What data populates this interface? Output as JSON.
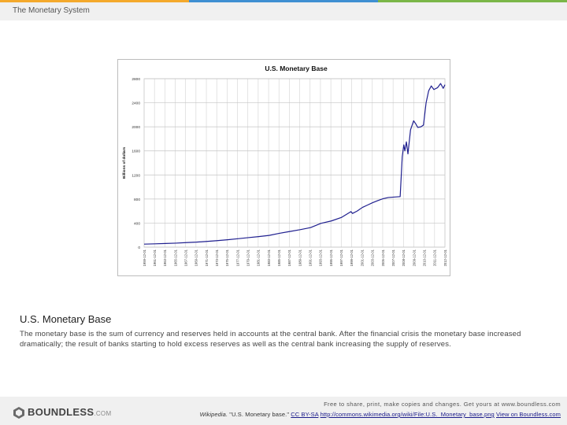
{
  "header": {
    "title": "The Monetary System"
  },
  "figure": {
    "caption_title": "U.S. Monetary Base",
    "caption_body": "The monetary base is the sum of currency and reserves held in accounts at the central bank. After the financial crisis the monetary base increased dramatically; the result of banks starting to hold excess reserves as well as the central bank increasing the supply of reserves."
  },
  "chart_data": {
    "type": "line",
    "title": "U.S. Monetary Base",
    "ylabel": "Billions of dollars",
    "xlabel": "",
    "ylim": [
      0,
      2800
    ],
    "yticks": [
      0,
      400,
      800,
      1200,
      1600,
      2000,
      2400,
      2800
    ],
    "grid": true,
    "line_color": "#1f1f8f",
    "x_tick_labels": [
      "1959-12-01",
      "1961-12-01",
      "1963-12-01",
      "1965-12-01",
      "1967-12-01",
      "1969-12-01",
      "1971-12-01",
      "1973-12-01",
      "1975-12-01",
      "1977-12-01",
      "1979-12-01",
      "1981-12-01",
      "1983-12-01",
      "1985-12-01",
      "1987-12-01",
      "1989-12-01",
      "1991-12-01",
      "1993-12-01",
      "1995-12-01",
      "1997-12-01",
      "1999-12-01",
      "2001-12-01",
      "2003-12-01",
      "2005-12-01",
      "2007-12-01",
      "2008-12-01",
      "2009-12-01",
      "2010-12-01",
      "2011-12-01",
      "2012-12-01"
    ],
    "series": [
      {
        "values": [
          {
            "x": 1959.9,
            "y": 50
          },
          {
            "x": 1962,
            "y": 55
          },
          {
            "x": 1964,
            "y": 60
          },
          {
            "x": 1966,
            "y": 66
          },
          {
            "x": 1968,
            "y": 75
          },
          {
            "x": 1970,
            "y": 83
          },
          {
            "x": 1972,
            "y": 95
          },
          {
            "x": 1974,
            "y": 108
          },
          {
            "x": 1976,
            "y": 123
          },
          {
            "x": 1978,
            "y": 140
          },
          {
            "x": 1980,
            "y": 158
          },
          {
            "x": 1982,
            "y": 175
          },
          {
            "x": 1984,
            "y": 195
          },
          {
            "x": 1986,
            "y": 230
          },
          {
            "x": 1988,
            "y": 260
          },
          {
            "x": 1990,
            "y": 290
          },
          {
            "x": 1992,
            "y": 325
          },
          {
            "x": 1994,
            "y": 395
          },
          {
            "x": 1996,
            "y": 435
          },
          {
            "x": 1998,
            "y": 495
          },
          {
            "x": 1999.8,
            "y": 590
          },
          {
            "x": 2000.1,
            "y": 560
          },
          {
            "x": 2001,
            "y": 600
          },
          {
            "x": 2002,
            "y": 660
          },
          {
            "x": 2003,
            "y": 700
          },
          {
            "x": 2004,
            "y": 740
          },
          {
            "x": 2005,
            "y": 775
          },
          {
            "x": 2006,
            "y": 805
          },
          {
            "x": 2007,
            "y": 825
          },
          {
            "x": 2008.6,
            "y": 840
          },
          {
            "x": 2008.8,
            "y": 1500
          },
          {
            "x": 2008.95,
            "y": 1700
          },
          {
            "x": 2009.05,
            "y": 1600
          },
          {
            "x": 2009.2,
            "y": 1750
          },
          {
            "x": 2009.35,
            "y": 1550
          },
          {
            "x": 2009.6,
            "y": 1950
          },
          {
            "x": 2009.9,
            "y": 2100
          },
          {
            "x": 2010.1,
            "y": 2050
          },
          {
            "x": 2010.3,
            "y": 1990
          },
          {
            "x": 2010.6,
            "y": 2000
          },
          {
            "x": 2010.85,
            "y": 2030
          },
          {
            "x": 2011.1,
            "y": 2400
          },
          {
            "x": 2011.35,
            "y": 2600
          },
          {
            "x": 2011.6,
            "y": 2680
          },
          {
            "x": 2011.85,
            "y": 2620
          },
          {
            "x": 2012.2,
            "y": 2650
          },
          {
            "x": 2012.5,
            "y": 2720
          },
          {
            "x": 2012.75,
            "y": 2640
          },
          {
            "x": 2012.95,
            "y": 2700
          }
        ]
      }
    ]
  },
  "footer": {
    "logo_text": "BOUNDLESS",
    "logo_suffix": ".COM",
    "line1": "Free to share, print, make copies and changes. Get yours at www.boundless.com",
    "source": "Wikipedia.",
    "quote": " \"U.S. Monetary base.\" ",
    "license": "CC BY-SA",
    "url": "http://commons.wikimedia.org/wiki/File:U.S._Monetary_base.png",
    "view_link": "View on Boundless.com"
  }
}
